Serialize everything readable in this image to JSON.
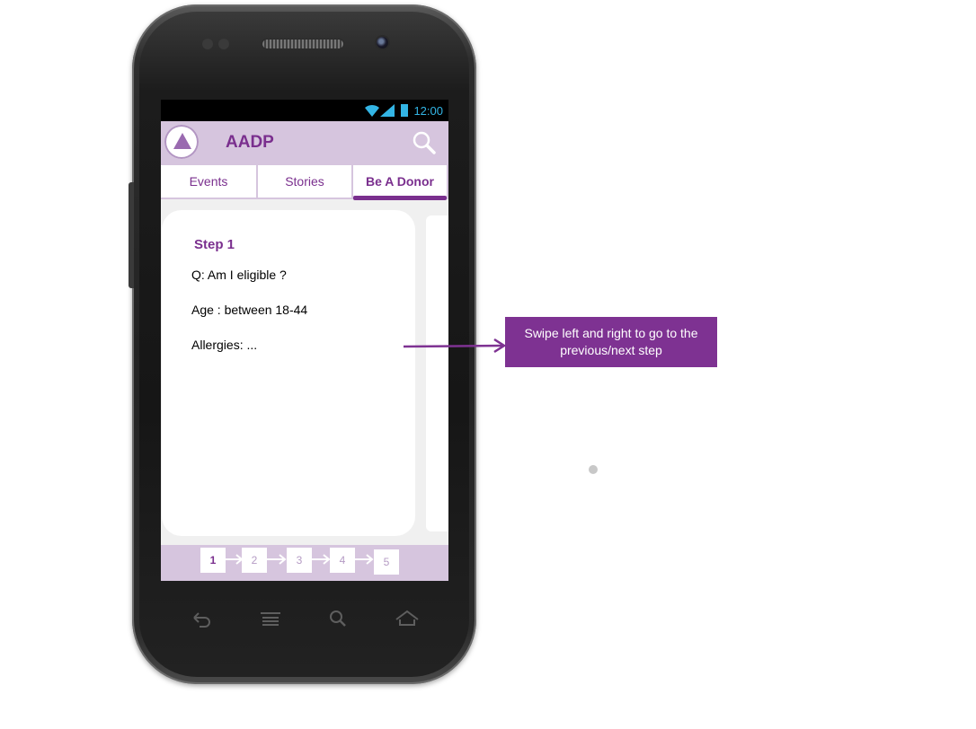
{
  "status_bar": {
    "time": "12:00"
  },
  "app": {
    "title": "AADP"
  },
  "tabs": [
    {
      "label": "Events",
      "active": false
    },
    {
      "label": "Stories",
      "active": false
    },
    {
      "label": "Be A Donor",
      "active": true
    }
  ],
  "card": {
    "title": "Step 1",
    "lines": [
      "Q: Am I eligible ?",
      "Age : between 18-44",
      "Allergies: ..."
    ]
  },
  "stepper": {
    "steps": [
      "1",
      "2",
      "3",
      "4",
      "5"
    ],
    "current": 1
  },
  "annotation": {
    "text": "Swipe left and right to go to the previous/next step"
  },
  "colors": {
    "accent": "#7a2f8e",
    "bar": "#d6c5de",
    "callout": "#7e3292",
    "status_icons": "#33b5e5"
  },
  "icons": [
    "back-icon",
    "menu-icon",
    "search-icon",
    "home-icon",
    "wifi-icon",
    "signal-icon",
    "battery-icon"
  ]
}
